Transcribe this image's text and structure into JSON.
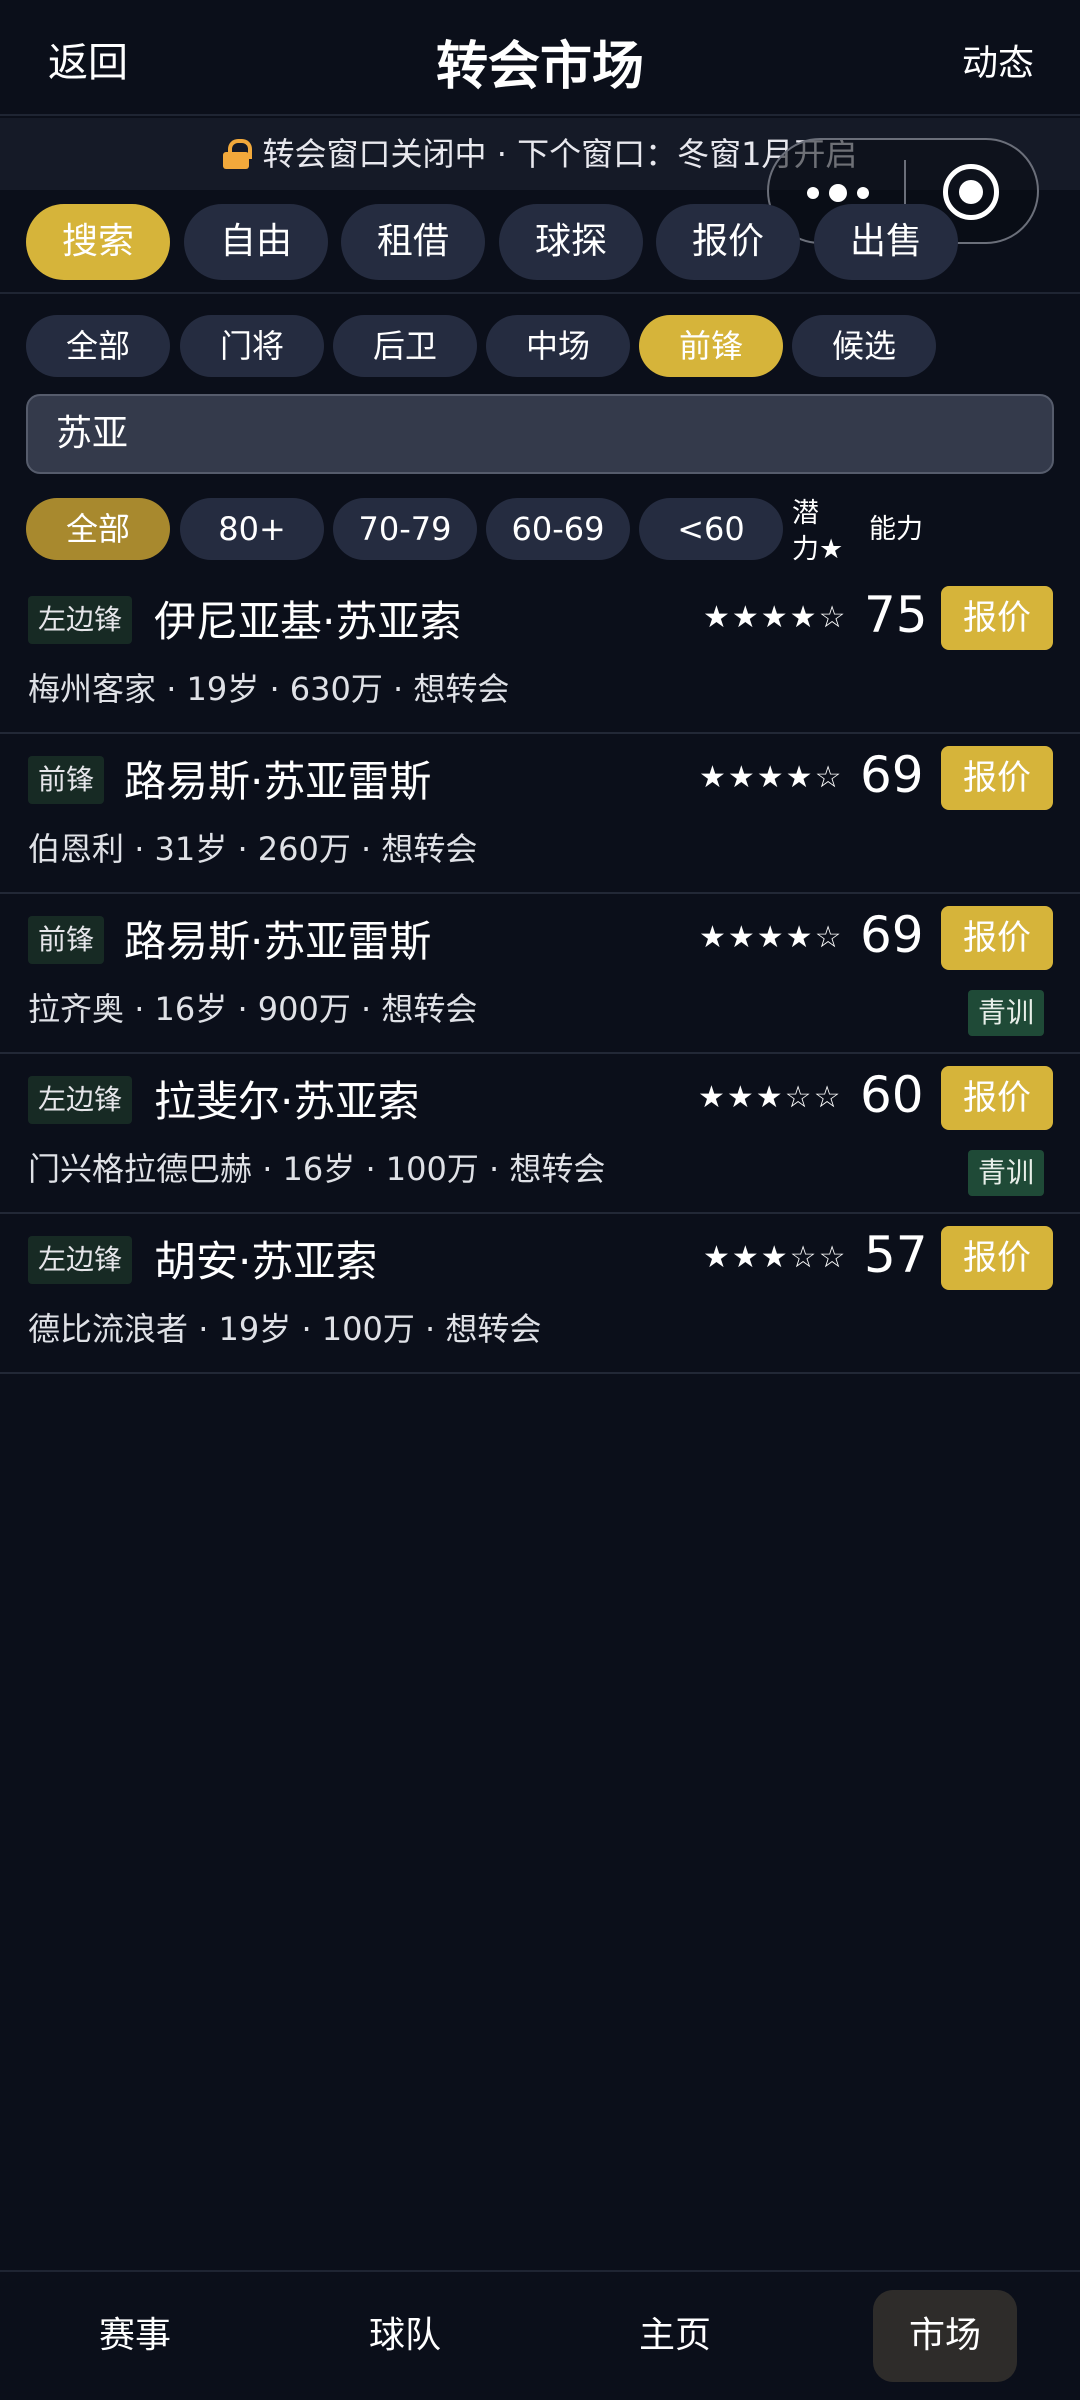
{
  "header": {
    "back": "返回",
    "title": "转会市场",
    "feed": "动态"
  },
  "notice": {
    "text": "转会窗口关闭中 · 下个窗口：冬窗1月开启",
    "icon": "lock-icon"
  },
  "main_tabs": [
    {
      "label": "搜索",
      "active": true
    },
    {
      "label": "自由",
      "active": false
    },
    {
      "label": "租借",
      "active": false
    },
    {
      "label": "球探",
      "active": false
    },
    {
      "label": "报价",
      "active": false
    },
    {
      "label": "出售",
      "active": false
    }
  ],
  "position_filters": [
    {
      "label": "全部",
      "active": false
    },
    {
      "label": "门将",
      "active": false
    },
    {
      "label": "后卫",
      "active": false
    },
    {
      "label": "中场",
      "active": false
    },
    {
      "label": "前锋",
      "active": true
    },
    {
      "label": "候选",
      "active": false
    }
  ],
  "search": {
    "value": "苏亚"
  },
  "rating_filters": [
    {
      "label": "全部",
      "active": true
    },
    {
      "label": "80+",
      "active": false
    },
    {
      "label": "70-79",
      "active": false
    },
    {
      "label": "60-69",
      "active": false
    },
    {
      "label": "<60",
      "active": false
    }
  ],
  "sort": {
    "potential_line1": "潜",
    "potential_line2": "力★",
    "ability": "能力"
  },
  "players": [
    {
      "position": "左边锋",
      "name": "伊尼亚基·苏亚索",
      "stars_text": "★★★★☆",
      "stars": 4,
      "rating": "75",
      "offer": "报价",
      "club": "梅州客家",
      "age": "19岁",
      "value": "630万",
      "status": "想转会",
      "youth": null
    },
    {
      "position": "前锋",
      "name": "路易斯·苏亚雷斯",
      "stars_text": "★★★★☆",
      "stars": 4,
      "rating": "69",
      "offer": "报价",
      "club": "伯恩利",
      "age": "31岁",
      "value": "260万",
      "status": "想转会",
      "youth": null
    },
    {
      "position": "前锋",
      "name": "路易斯·苏亚雷斯",
      "stars_text": "★★★★☆",
      "stars": 4,
      "rating": "69",
      "offer": "报价",
      "club": "拉齐奥",
      "age": "16岁",
      "value": "900万",
      "status": "想转会",
      "youth": "青训"
    },
    {
      "position": "左边锋",
      "name": "拉斐尔·苏亚索",
      "stars_text": "★★★☆☆",
      "stars": 3,
      "rating": "60",
      "offer": "报价",
      "club": "门兴格拉德巴赫",
      "age": "16岁",
      "value": "100万",
      "status": "想转会",
      "youth": "青训"
    },
    {
      "position": "左边锋",
      "name": "胡安·苏亚索",
      "stars_text": "★★★☆☆",
      "stars": 3,
      "rating": "57",
      "offer": "报价",
      "club": "德比流浪者",
      "age": "19岁",
      "value": "100万",
      "status": "想转会",
      "youth": null
    }
  ],
  "bottom_nav": [
    {
      "label": "赛事",
      "active": false
    },
    {
      "label": "球队",
      "active": false
    },
    {
      "label": "主页",
      "active": false
    },
    {
      "label": "市场",
      "active": true
    }
  ],
  "colors": {
    "background": "#0b0f1a",
    "accent": "#d6b43a",
    "chip": "#252c40",
    "youth_badge": "#1f4a37",
    "lock": "#f2a93b"
  }
}
